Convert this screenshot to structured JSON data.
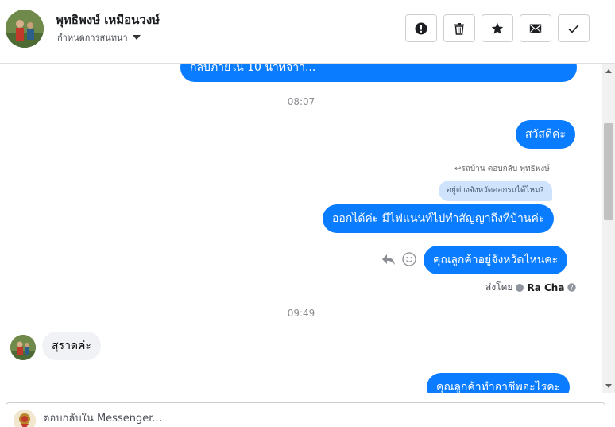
{
  "header": {
    "contact_name": "พุทธิพงษ์ เหมือนวงษ์",
    "assign_label": "กำหนดการสนทนา",
    "actions": [
      {
        "icon": "alert-circle-icon"
      },
      {
        "icon": "trash-icon"
      },
      {
        "icon": "star-icon"
      },
      {
        "icon": "envelope-icon"
      },
      {
        "icon": "checkmark-icon"
      }
    ]
  },
  "messages": {
    "top_partial_out": "กลับภายใน 10 นาทีจ้าา...",
    "time_1": "08:07",
    "greeting_out": "สวัสดีค่ะ",
    "reply_note": "รถบ้าน ตอบกลับ พุทธิพงษ์",
    "quoted_text": "อยู่ต่างจังหวัดออกรถได้ไหม?",
    "reply_out": "ออกได้ค่ะ มีไฟแนนท์ไปทำสัญญาถึงที่บ้านค่ะ",
    "question_out": "คุณลูกค้าอยู่จังหวัดไหนคะ",
    "sent_by_label": "ส่งโดย",
    "sent_by_name": "Ra Cha",
    "time_2": "09:49",
    "incoming": "สุราดค่ะ",
    "bottom_partial_out": "คุณลูกค้าทำอาชีพอะไรคะ"
  },
  "composer": {
    "placeholder": "ตอบกลับใน Messenger..."
  },
  "colors": {
    "outgoing_bubble": "#0a7cff",
    "incoming_bubble": "#f0f2f5",
    "quoted_bubble": "#cfe3fc"
  }
}
